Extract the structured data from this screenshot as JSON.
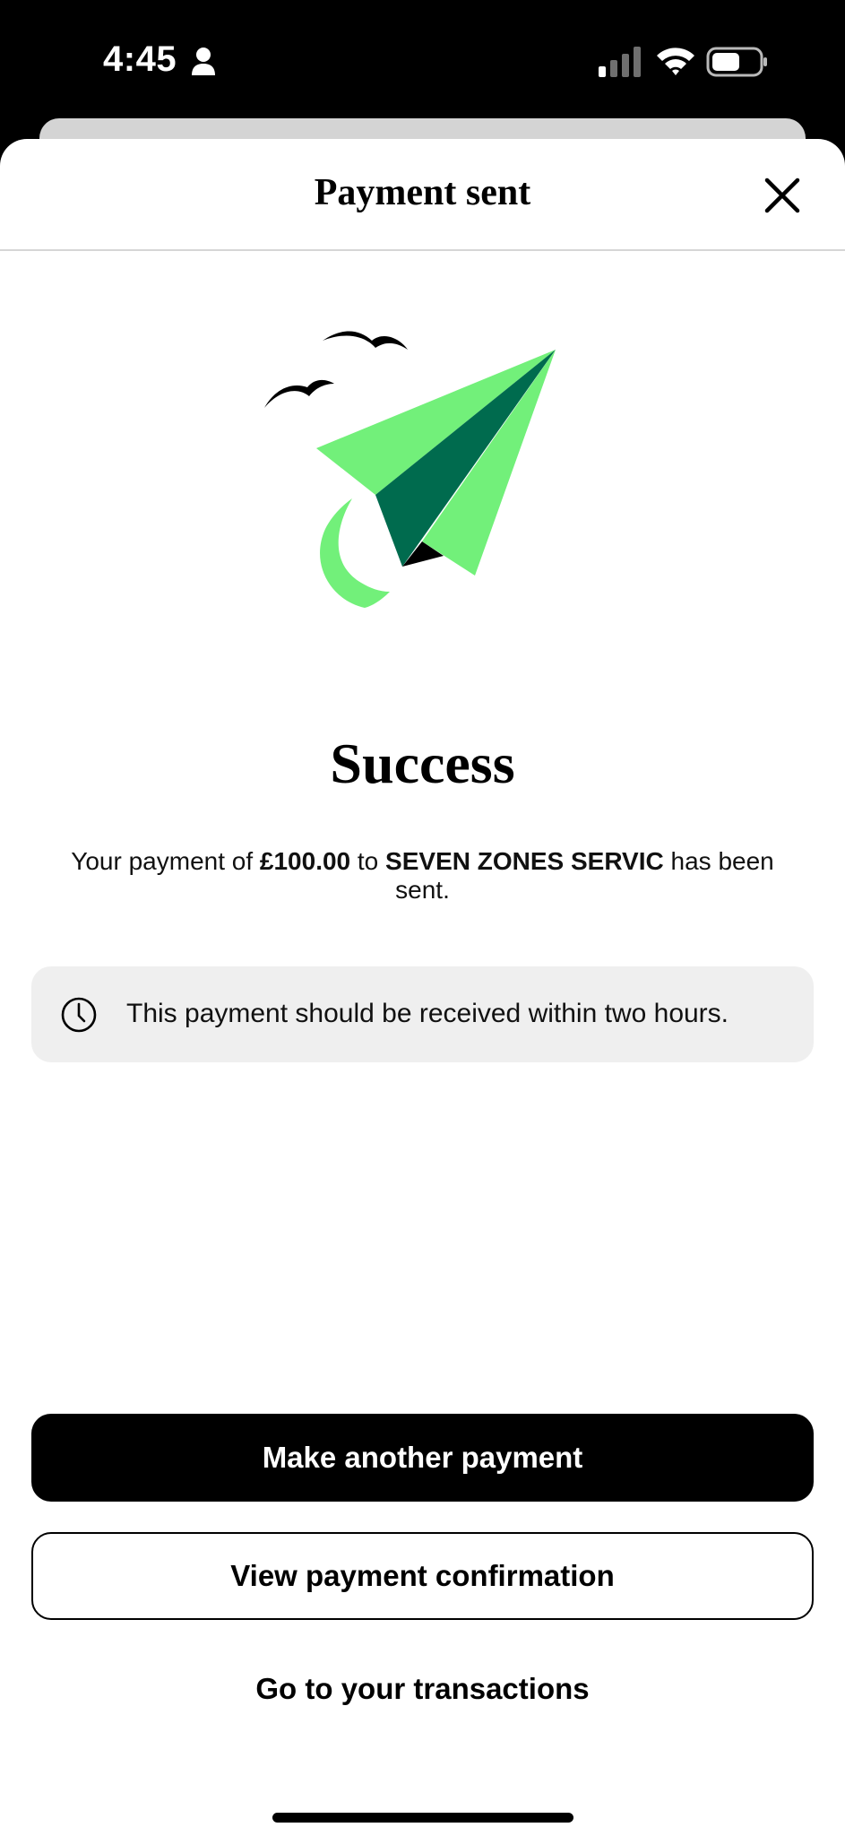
{
  "status_bar": {
    "time": "4:45",
    "icons": [
      "person-icon",
      "signal-icon",
      "wifi-icon",
      "battery-icon"
    ]
  },
  "sheet": {
    "title": "Payment sent",
    "close_icon": "close-icon"
  },
  "illustration": {
    "name": "paper-plane-illustration",
    "colors": {
      "light_green": "#72F07A",
      "dark_green": "#006B4E",
      "ink": "#000000"
    }
  },
  "result": {
    "heading": "Success",
    "message_prefix": "Your payment of ",
    "amount": "£100.00",
    "message_middle": " to ",
    "recipient": "SEVEN ZONES SERVIC",
    "message_suffix": " has been sent."
  },
  "info": {
    "icon": "clock-icon",
    "text": "This payment should be received within two hours."
  },
  "actions": {
    "primary_label": "Make another payment",
    "secondary_label": "View payment confirmation",
    "link_label": "Go to your transactions"
  },
  "colors": {
    "primary_button_bg": "#000000",
    "info_box_bg": "#EFEFEF",
    "sheet_bg": "#FFFFFF"
  }
}
